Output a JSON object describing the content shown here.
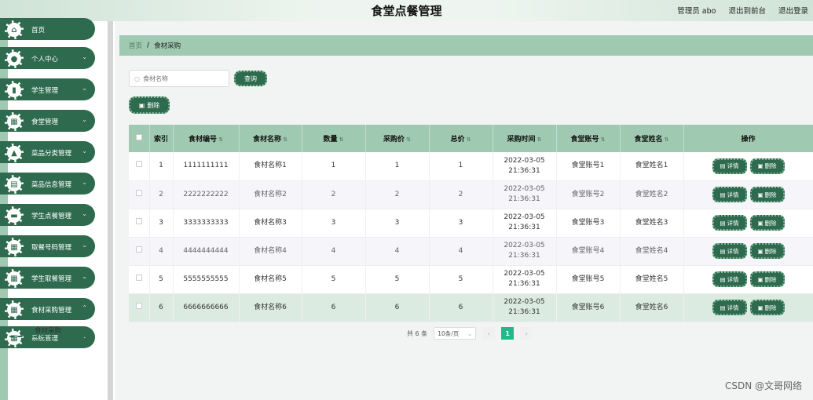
{
  "app": {
    "title": "食堂点餐管理",
    "user_label": "管理员 abo",
    "back_link": "退出到前台",
    "logout_link": "退出登录"
  },
  "sidebar": {
    "items": [
      {
        "label": "首页",
        "icon": "home-icon",
        "glyph": "⌂"
      },
      {
        "label": "个人中心",
        "icon": "user-icon",
        "glyph": "●",
        "chevron": "⌄"
      },
      {
        "label": "学生管理",
        "icon": "chart-icon",
        "glyph": "▮",
        "chevron": "⌄"
      },
      {
        "label": "食堂管理",
        "icon": "grid-icon",
        "glyph": "▦",
        "chevron": "⌄"
      },
      {
        "label": "菜品分类管理",
        "icon": "building-icon",
        "glyph": "▲",
        "chevron": "⌄"
      },
      {
        "label": "菜品信息管理",
        "icon": "clipboard-icon",
        "glyph": "▤",
        "chevron": "⌄"
      },
      {
        "label": "学生点餐管理",
        "icon": "briefcase-icon",
        "glyph": "▬",
        "chevron": "⌄"
      },
      {
        "label": "取餐号码管理",
        "icon": "grid-icon",
        "glyph": "▦",
        "chevron": "⌄"
      },
      {
        "label": "学生取餐管理",
        "icon": "grid-icon",
        "glyph": "▦",
        "chevron": "⌄"
      },
      {
        "label": "食材采购管理",
        "icon": "grid-icon",
        "glyph": "▦",
        "chevron": "⌃"
      },
      {
        "label": "系统管理",
        "icon": "grid-icon",
        "glyph": "▦",
        "chevron": "⌄"
      }
    ],
    "sub_item": "食材采购"
  },
  "breadcrumb": {
    "home": "首页",
    "separator": "/",
    "current": "食材采购"
  },
  "search": {
    "placeholder": "食材名称",
    "value": "",
    "button": "查询"
  },
  "actions": {
    "delete": "删除"
  },
  "table": {
    "headers": [
      "",
      "索引",
      "食材编号",
      "食材名称",
      "数量",
      "采购价",
      "总价",
      "采购时间",
      "食堂账号",
      "食堂姓名",
      "操作"
    ],
    "rows": [
      [
        "1",
        "1111111111",
        "食材名称1",
        "1",
        "1",
        "1",
        "2022-03-05 21:36:31",
        "食堂账号1",
        "食堂姓名1"
      ],
      [
        "2",
        "2222222222",
        "食材名称2",
        "2",
        "2",
        "2",
        "2022-03-05 21:36:31",
        "食堂账号2",
        "食堂姓名2"
      ],
      [
        "3",
        "3333333333",
        "食材名称3",
        "3",
        "3",
        "3",
        "2022-03-05 21:36:31",
        "食堂账号3",
        "食堂姓名3"
      ],
      [
        "4",
        "4444444444",
        "食材名称4",
        "4",
        "4",
        "4",
        "2022-03-05 21:36:31",
        "食堂账号4",
        "食堂姓名4"
      ],
      [
        "5",
        "5555555555",
        "食材名称5",
        "5",
        "5",
        "5",
        "2022-03-05 21:36:31",
        "食堂账号5",
        "食堂姓名5"
      ],
      [
        "6",
        "6666666666",
        "食材名称6",
        "6",
        "6",
        "6",
        "2022-03-05 21:36:31",
        "食堂账号6",
        "食堂姓名6"
      ]
    ],
    "row_buttons": {
      "detail": "详情",
      "delete": "删除"
    }
  },
  "pagination": {
    "total": "共 6 条",
    "page_size": "10条/页",
    "current_page": "1",
    "prev": "‹",
    "next": "›"
  },
  "watermark": "CSDN @文哥网络",
  "colors": {
    "primary": "#2e6b4e",
    "header": "#9fc9b0",
    "page_active": "#1fb98a"
  }
}
